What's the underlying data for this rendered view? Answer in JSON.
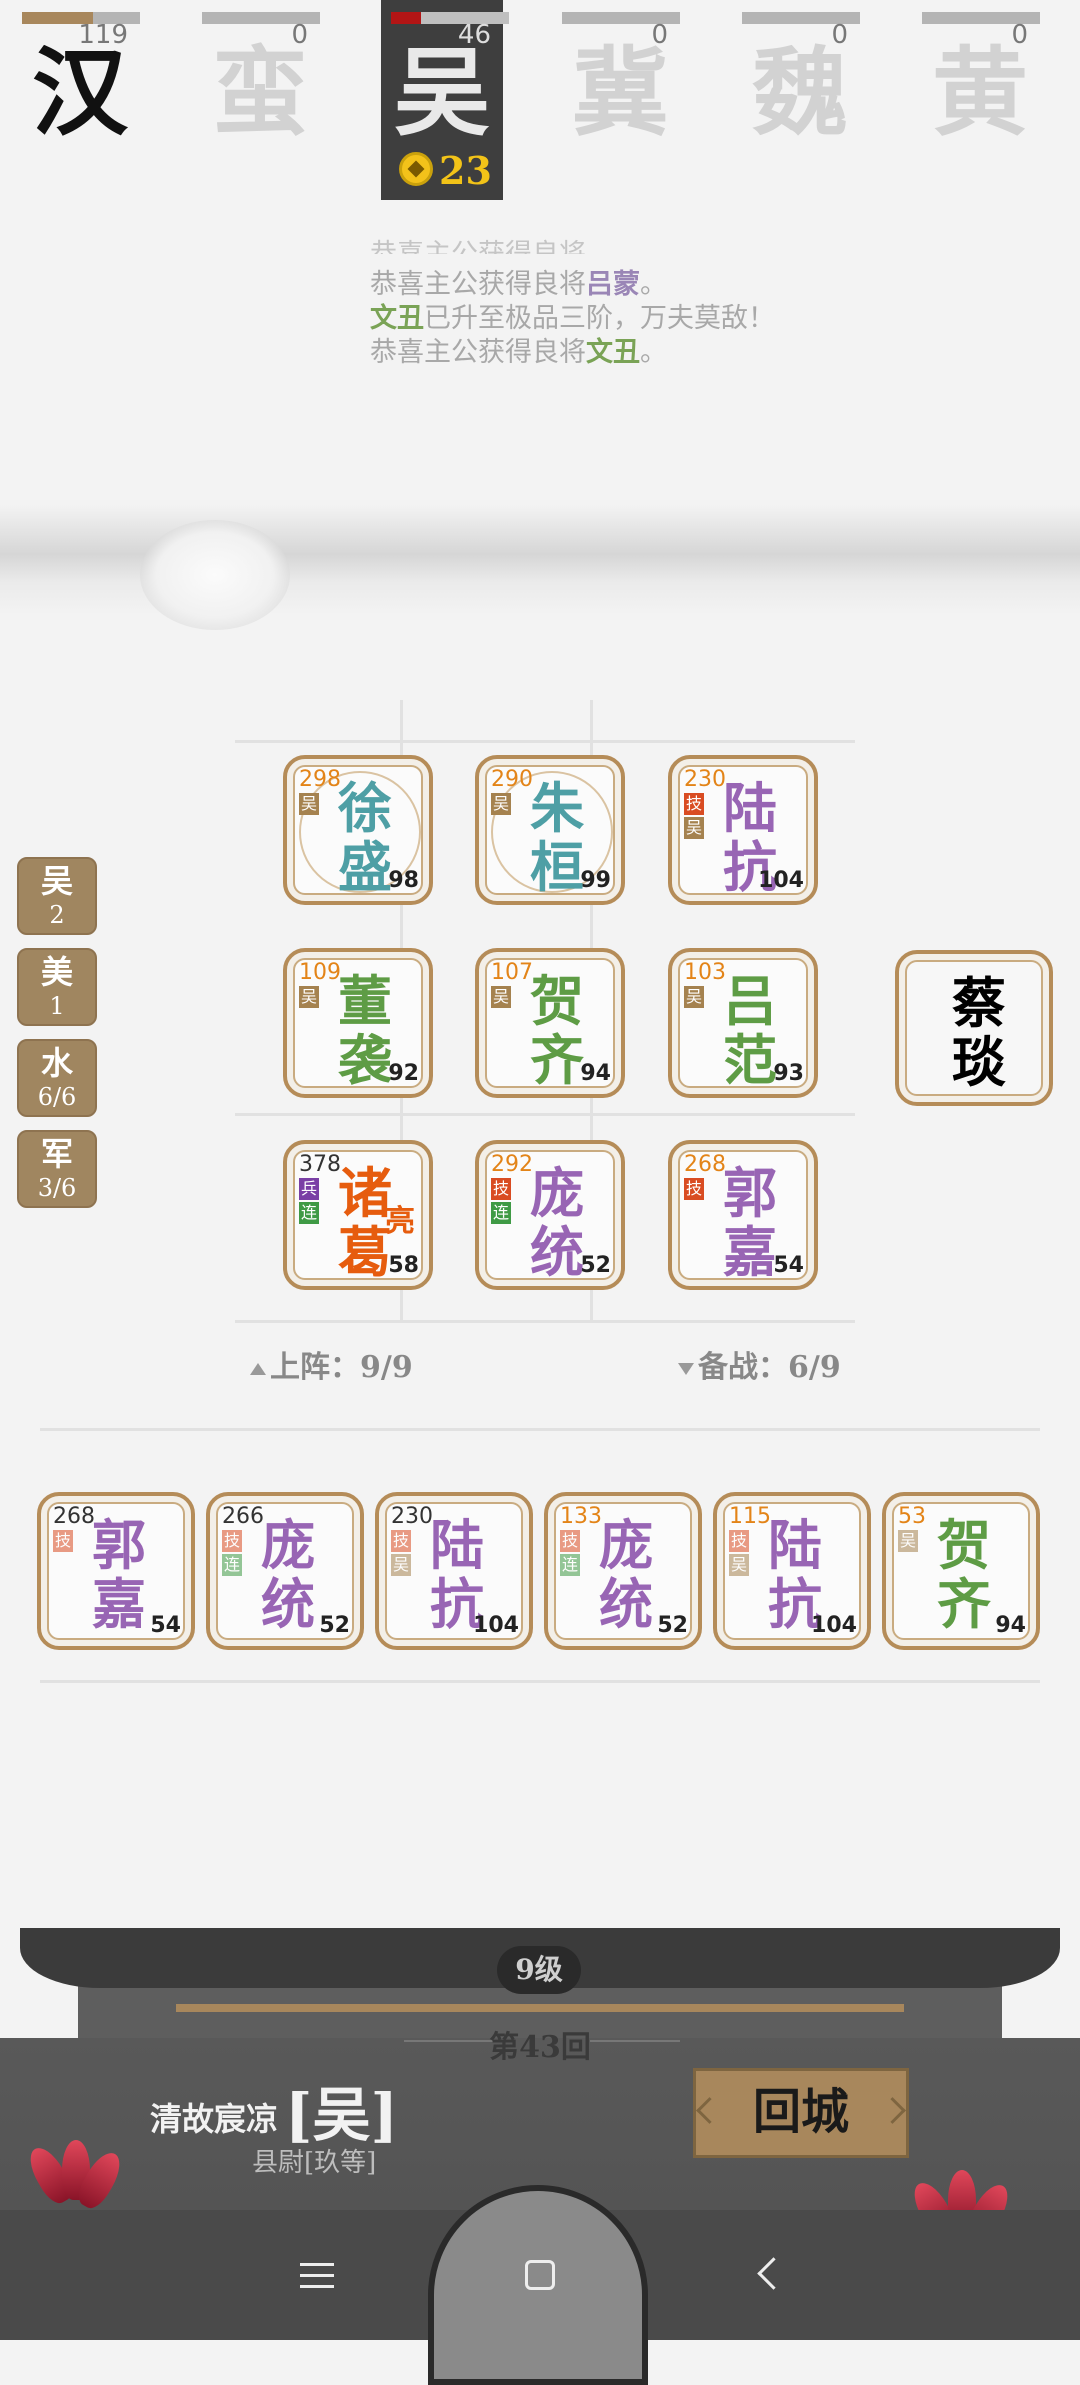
{
  "kingdoms": [
    {
      "name": "汉",
      "count": "119",
      "fill": 0.6,
      "state": "black"
    },
    {
      "name": "蛮",
      "count": "0",
      "fill": 0,
      "state": "dim"
    },
    {
      "name": "吴",
      "count": "46",
      "fill": 0.25,
      "state": "active"
    },
    {
      "name": "冀",
      "count": "0",
      "fill": 0,
      "state": "dim"
    },
    {
      "name": "魏",
      "count": "0",
      "fill": 0,
      "state": "dim"
    },
    {
      "name": "黄",
      "count": "0",
      "fill": 0,
      "state": "dim"
    }
  ],
  "gold": "23",
  "messages": [
    {
      "pre": "恭喜主公获得良将",
      "hero": "吕蒙",
      "post": "。",
      "color": "purple"
    },
    {
      "pre": "",
      "hero": "文丑",
      "post": "已升至极品三阶，万夫莫敌！",
      "color": "green"
    },
    {
      "pre": "恭喜主公获得良将",
      "hero": "文丑",
      "post": "。",
      "color": "green"
    }
  ],
  "side_tags": [
    {
      "label": "吴",
      "value": "2"
    },
    {
      "label": "美",
      "value": "1"
    },
    {
      "label": "水",
      "value": "6/6"
    },
    {
      "label": "军",
      "value": "3/6"
    }
  ],
  "board": [
    {
      "name1": "徐",
      "name2": "盛",
      "num": "298",
      "level": "98",
      "color": "#4e9fa5",
      "badges": [
        "吴"
      ],
      "ring": true
    },
    {
      "name1": "朱",
      "name2": "桓",
      "num": "290",
      "level": "99",
      "color": "#4e9fa5",
      "badges": [
        "吴"
      ],
      "ring": true
    },
    {
      "name1": "陆",
      "name2": "抗",
      "num": "230",
      "level": "104",
      "color": "#9865b4",
      "badges": [
        "技",
        "吴"
      ],
      "ring": false
    },
    {
      "name1": "董",
      "name2": "袭",
      "num": "109",
      "level": "92",
      "color": "#5e9c45",
      "badges": [
        "吴"
      ],
      "ring": false
    },
    {
      "name1": "贺",
      "name2": "齐",
      "num": "107",
      "level": "94",
      "color": "#5e9c45",
      "badges": [
        "吴"
      ],
      "ring": false
    },
    {
      "name1": "吕",
      "name2": "范",
      "num": "103",
      "level": "93",
      "color": "#5e9c45",
      "badges": [
        "吴"
      ],
      "ring": false
    },
    {
      "name1": "诸",
      "name2": "葛",
      "num": "378",
      "level": "58",
      "color": "#e65c0e",
      "badges": [
        "兵",
        "连"
      ],
      "extra": "亮",
      "ring": false
    },
    {
      "name1": "庞",
      "name2": "统",
      "num": "292",
      "level": "52",
      "color": "#9865b4",
      "badges": [
        "技",
        "连"
      ],
      "ring": false
    },
    {
      "name1": "郭",
      "name2": "嘉",
      "num": "268",
      "level": "54",
      "color": "#9865b4",
      "badges": [
        "技"
      ],
      "ring": false
    }
  ],
  "side_hero": {
    "name1": "蔡",
    "name2": "琰",
    "color": "#a8875c"
  },
  "deploy_label": "上阵：9/9",
  "reserve_label": "备战：6/9",
  "bench": [
    {
      "name1": "郭",
      "name2": "嘉",
      "num": "268",
      "level": "54",
      "color": "#9865b4",
      "badges": [
        "技"
      ]
    },
    {
      "name1": "庞",
      "name2": "统",
      "num": "266",
      "level": "52",
      "color": "#9865b4",
      "badges": [
        "技",
        "连"
      ]
    },
    {
      "name1": "陆",
      "name2": "抗",
      "num": "230",
      "level": "104",
      "color": "#9865b4",
      "badges": [
        "技",
        "吴"
      ]
    },
    {
      "name1": "庞",
      "name2": "统",
      "num": "133",
      "level": "52",
      "color": "#9865b4",
      "badges": [
        "技",
        "连"
      ]
    },
    {
      "name1": "陆",
      "name2": "抗",
      "num": "115",
      "level": "104",
      "color": "#9865b4",
      "badges": [
        "技",
        "吴"
      ]
    },
    {
      "name1": "贺",
      "name2": "齐",
      "num": "53",
      "level": "94",
      "color": "#5e9c45",
      "badges": [
        "吴"
      ]
    }
  ],
  "level_label": "9级",
  "round_label": "第43回",
  "player": {
    "title": "清故宸凉",
    "kingdom": "[吴]",
    "rank": "县尉[玖等]"
  },
  "return_button": "回城"
}
